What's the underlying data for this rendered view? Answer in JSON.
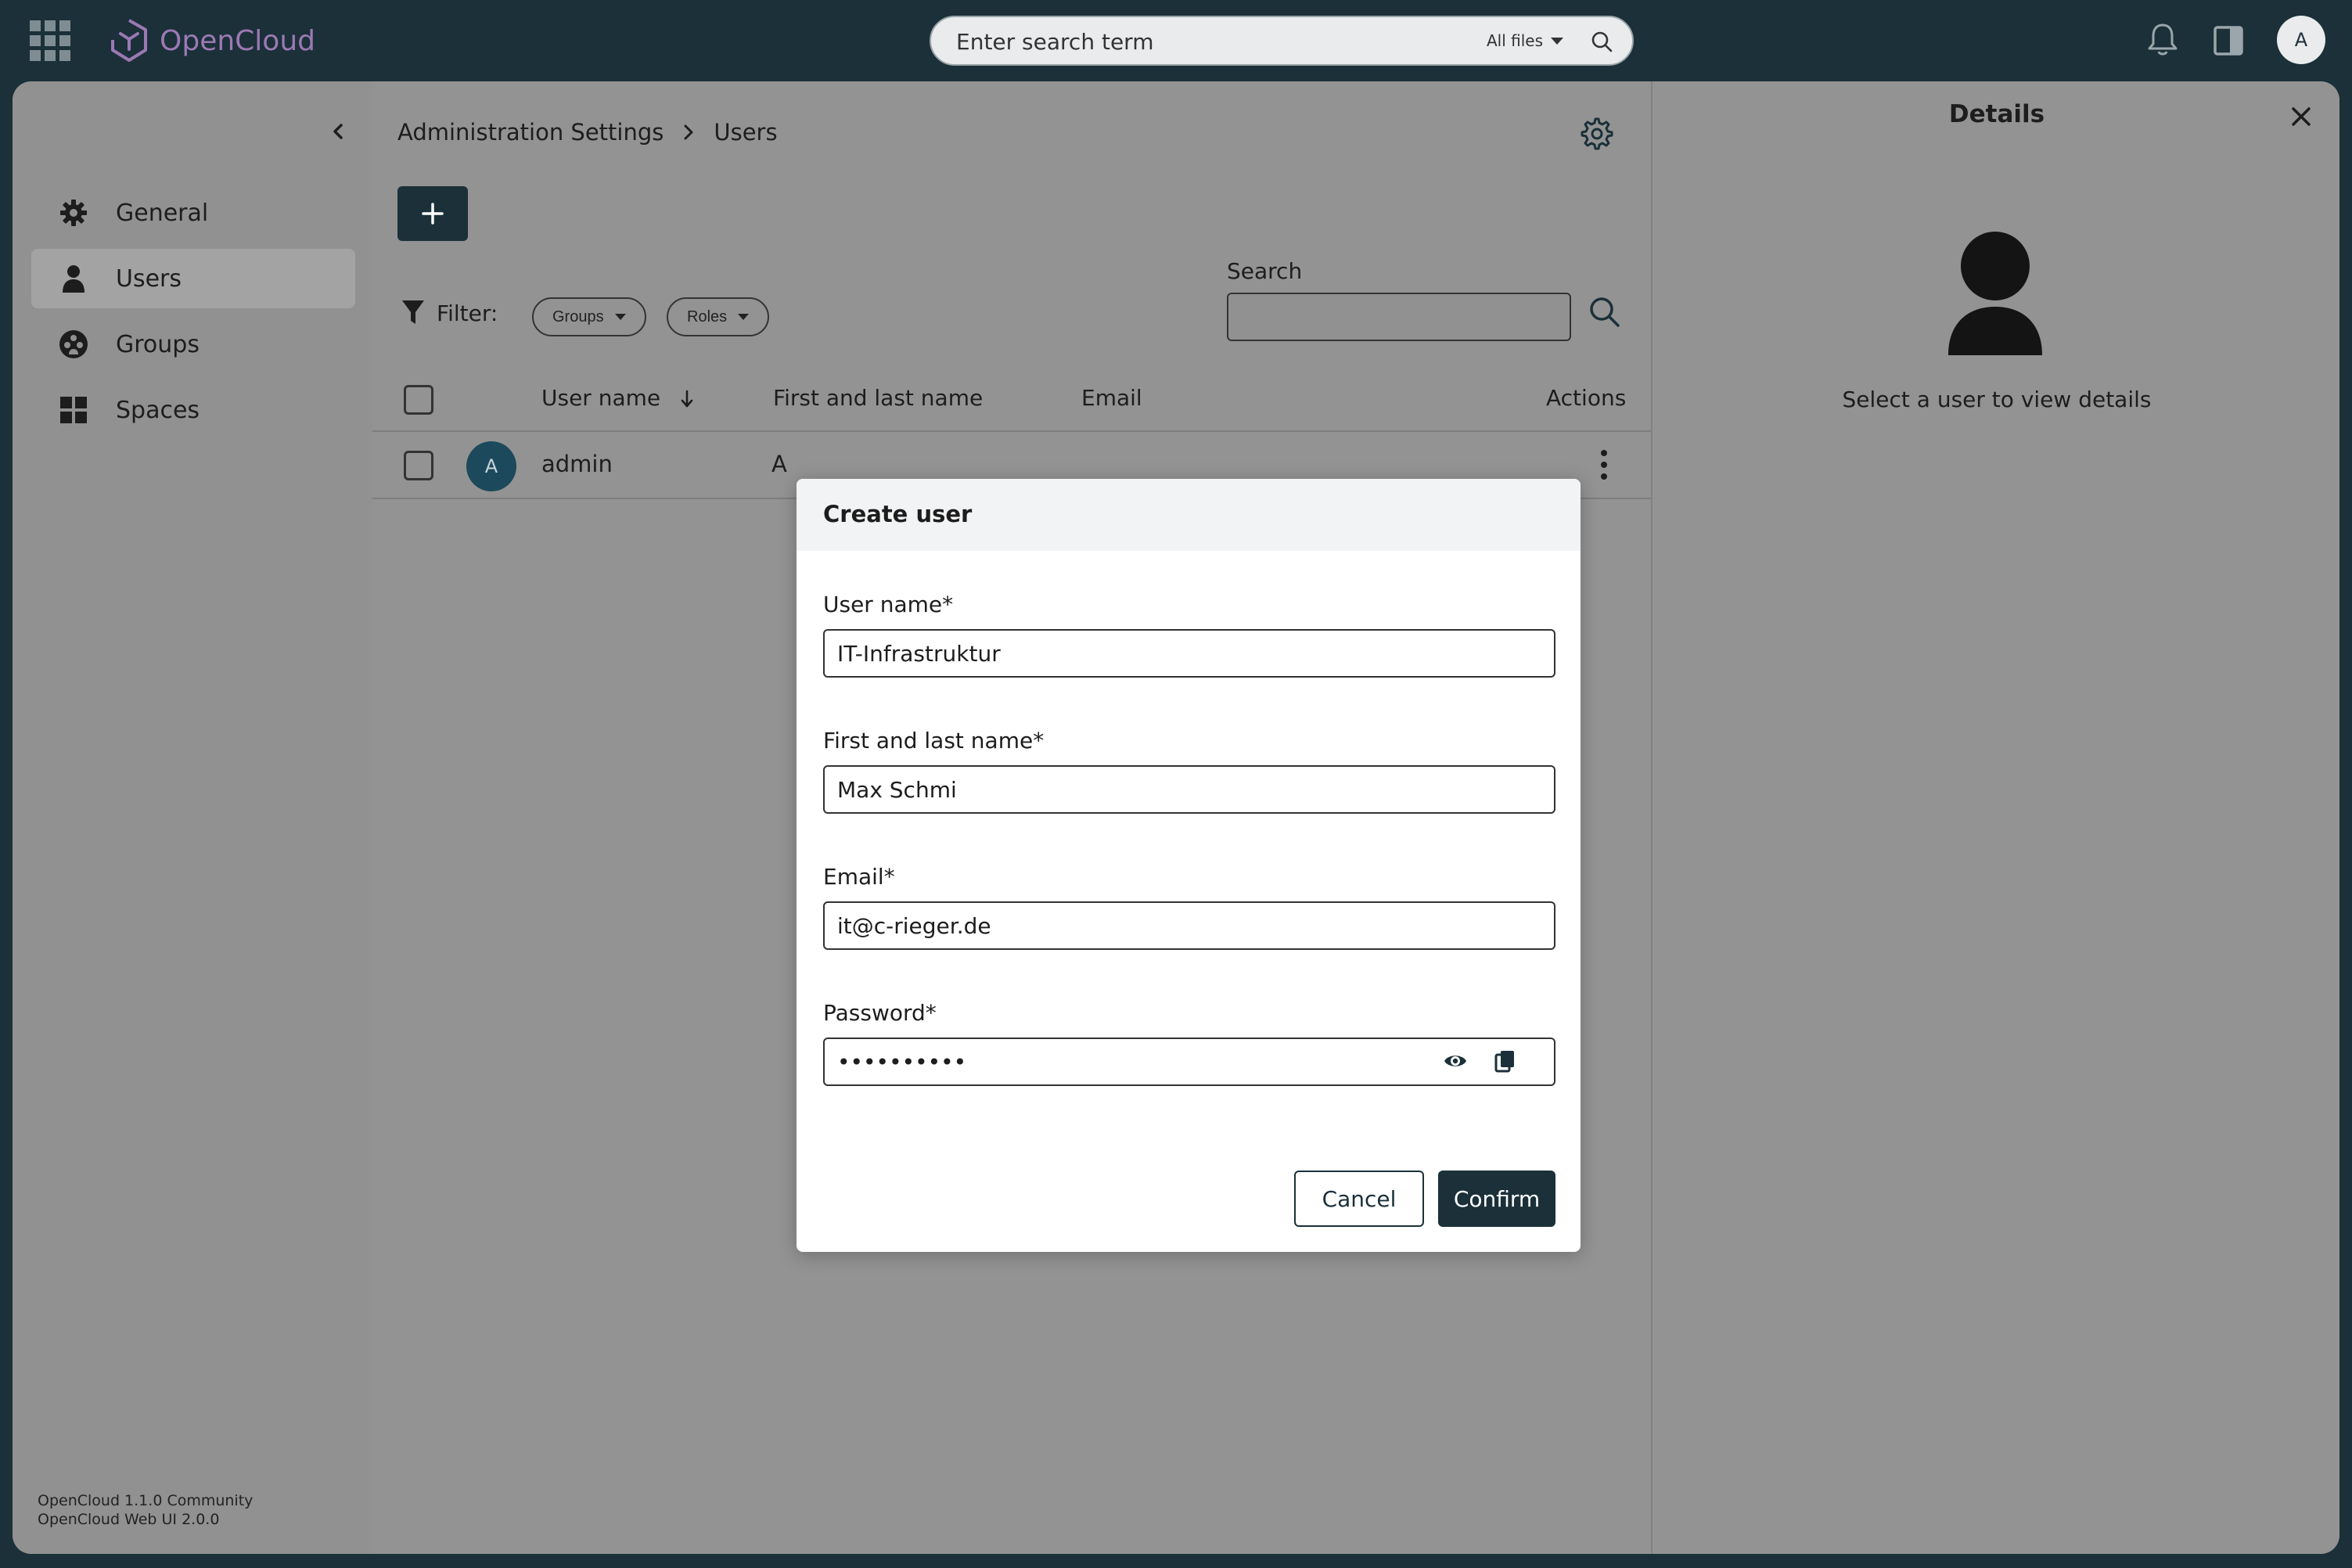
{
  "app": {
    "brand": "OpenCloud",
    "colors": {
      "accent": "#1b3039",
      "brand": "#9b79b3",
      "avatar": "#1c4a5c"
    }
  },
  "topbar": {
    "search_placeholder": "Enter search term",
    "search_scope": "All files",
    "user_initial": "A"
  },
  "sidebar": {
    "items": [
      {
        "label": "General",
        "icon": "gear-icon",
        "active": false
      },
      {
        "label": "Users",
        "icon": "user-icon",
        "active": true
      },
      {
        "label": "Groups",
        "icon": "groups-icon",
        "active": false
      },
      {
        "label": "Spaces",
        "icon": "spaces-grid-icon",
        "active": false
      }
    ],
    "version_line1": "OpenCloud 1.1.0 Community",
    "version_line2": "OpenCloud Web UI 2.0.0"
  },
  "main": {
    "breadcrumb": [
      "Administration Settings",
      "Users"
    ],
    "filter_label": "Filter:",
    "filters": [
      "Groups",
      "Roles"
    ],
    "search_label": "Search",
    "table": {
      "columns": [
        "User name",
        "First and last name",
        "Email",
        "Actions"
      ],
      "rows": [
        {
          "initial": "A",
          "username": "admin",
          "partial": "A"
        }
      ]
    }
  },
  "details": {
    "title": "Details",
    "hint": "Select a user to view details"
  },
  "modal": {
    "title": "Create user",
    "fields": {
      "username_label": "User name*",
      "username_value": "IT-Infrastruktur",
      "fullname_label": "First and last name*",
      "fullname_value": "Max Schmi",
      "email_label": "Email*",
      "email_value": "it@c-rieger.de",
      "password_label": "Password*",
      "password_value": "••••••••••"
    },
    "cancel": "Cancel",
    "confirm": "Confirm"
  }
}
